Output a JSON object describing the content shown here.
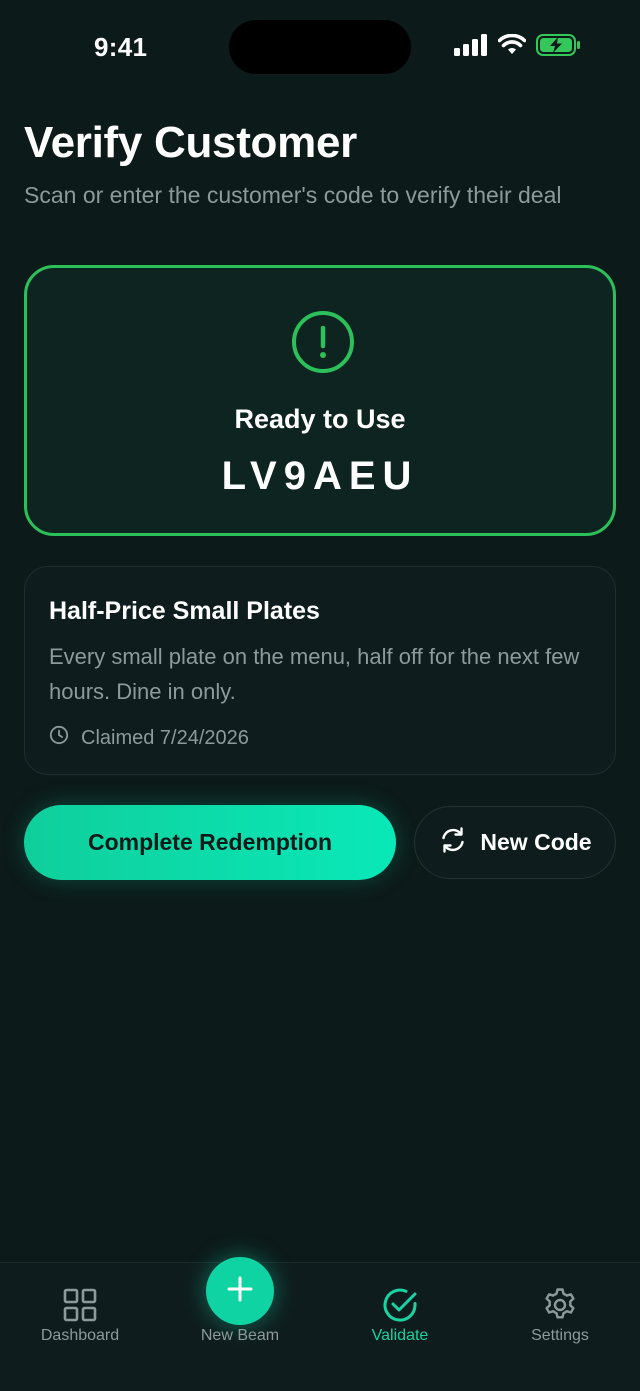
{
  "status_bar": {
    "time": "9:41",
    "signal_icon": "cellular-signal-icon",
    "wifi_icon": "wifi-icon",
    "battery_icon": "battery-charging-icon"
  },
  "header": {
    "title": "Verify Customer",
    "subtitle": "Scan or enter the customer's code to verify their deal"
  },
  "status_card": {
    "icon": "alert-circle-icon",
    "label": "Ready to Use",
    "code": "LV9AEU",
    "accent_color": "#2cc05a"
  },
  "deal": {
    "title": "Half-Price Small Plates",
    "description": "Every small plate on the menu, half off for the next few hours. Dine in only.",
    "claimed_icon": "clock-icon",
    "claimed_text": "Claimed 7/24/2026"
  },
  "actions": {
    "complete_label": "Complete Redemption",
    "new_code_label": "New Code",
    "new_code_icon": "refresh-icon"
  },
  "tab_bar": {
    "items": [
      {
        "label": "Dashboard",
        "icon": "grid-icon",
        "active": false
      },
      {
        "label": "New Beam",
        "icon": "plus-icon",
        "active": false
      },
      {
        "label": "Validate",
        "icon": "check-circle-icon",
        "active": true
      },
      {
        "label": "Settings",
        "icon": "gear-icon",
        "active": false
      }
    ],
    "accent_color": "#19d3a2"
  }
}
